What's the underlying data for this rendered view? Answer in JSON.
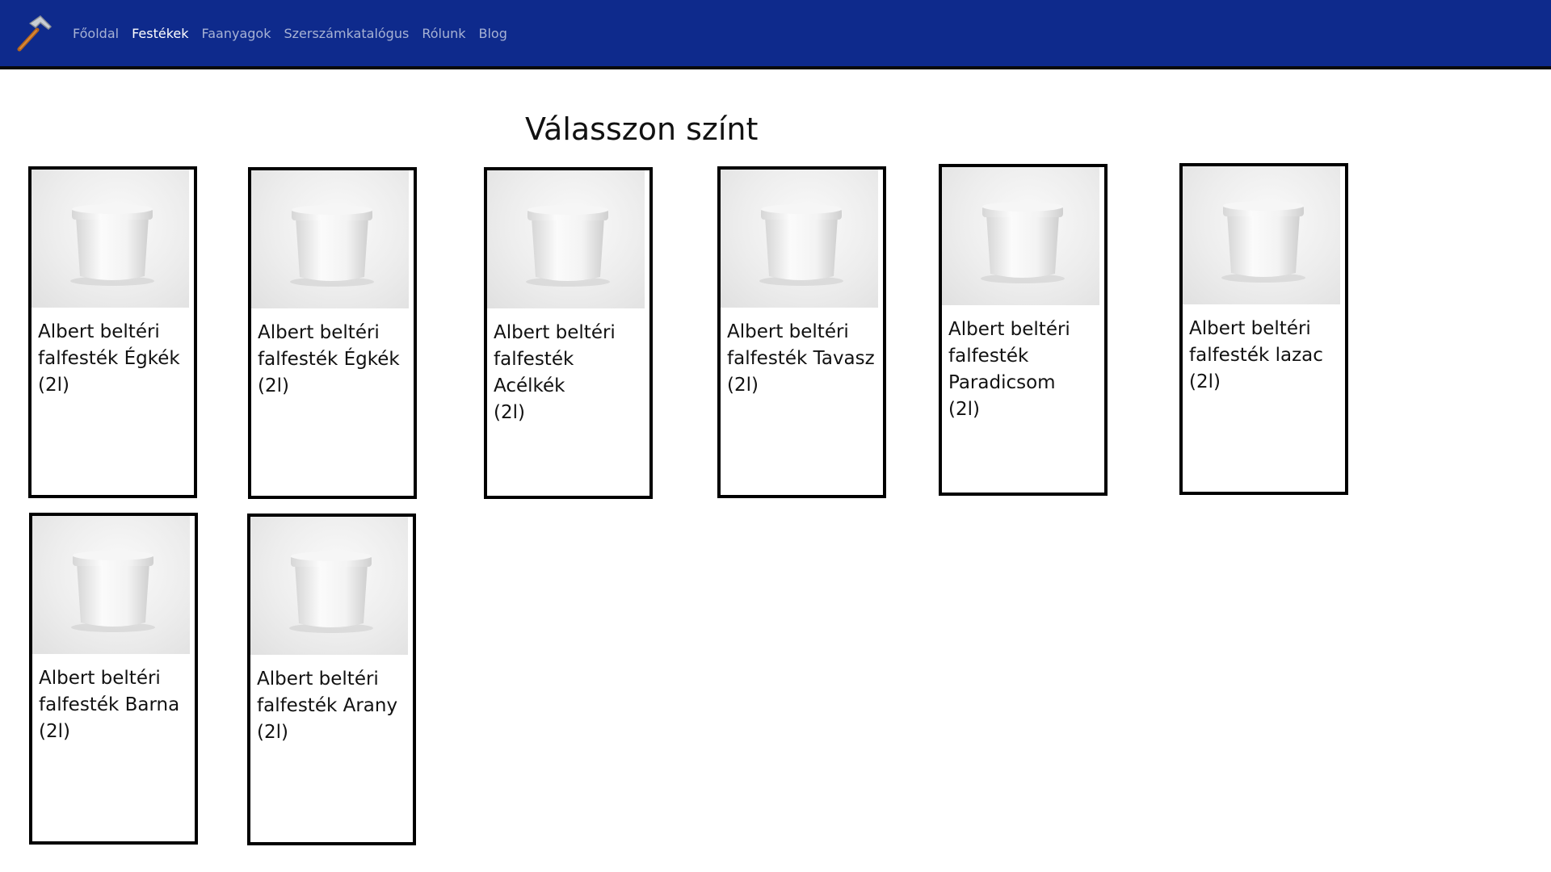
{
  "nav": {
    "logo_icon": "hammer-icon",
    "links": [
      {
        "label": "Főoldal",
        "active": false
      },
      {
        "label": "Festékek",
        "active": true
      },
      {
        "label": "Faanyagok",
        "active": false
      },
      {
        "label": "Szerszámkatalógus",
        "active": false
      },
      {
        "label": "Rólunk",
        "active": false
      },
      {
        "label": "Blog",
        "active": false
      }
    ]
  },
  "main": {
    "title": "Válasszon színt",
    "products": [
      {
        "name": "Albert beltéri\nfalfesték Égkék\n(2l)",
        "image_icon": "paint-bucket-image"
      },
      {
        "name": "Albert beltéri\nfalfesték Égkék\n (2l)",
        "image_icon": "paint-bucket-image"
      },
      {
        "name": "Albert beltéri\nfalfesték Acélkék\n (2l)",
        "image_icon": "paint-bucket-image"
      },
      {
        "name": "Albert beltéri\nfalfesték Tavasz\n(2l)",
        "image_icon": "paint-bucket-image"
      },
      {
        "name": "Albert beltéri\nfalfesték\nParadicsom\n (2l)",
        "image_icon": "paint-bucket-image"
      },
      {
        "name": "Albert beltéri\nfalfesték lazac (2l)",
        "image_icon": "paint-bucket-image"
      },
      {
        "name": "Albert beltéri\nfalfesték Barna\n(2l)",
        "image_icon": "paint-bucket-image"
      },
      {
        "name": "Albert beltéri\nfalfesték Arany\n (2l)",
        "image_icon": "paint-bucket-image"
      }
    ]
  },
  "colors": {
    "navbar_bg": "#0e2a8c",
    "nav_link": "#a7b2d4",
    "nav_link_active": "#ffffff"
  }
}
